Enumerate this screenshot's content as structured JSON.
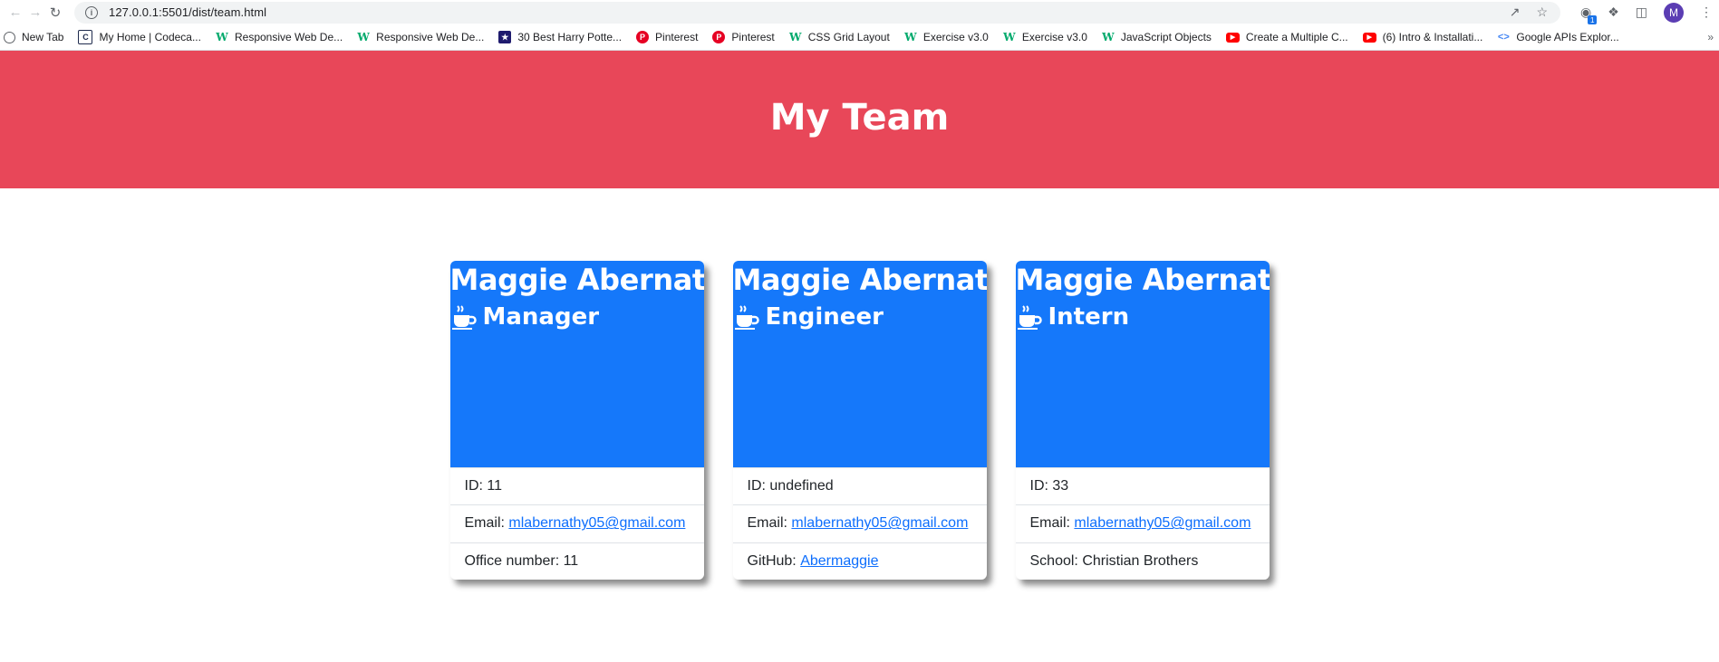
{
  "browser": {
    "url": "127.0.0.1:5501/dist/team.html",
    "avatar_letter": "M",
    "extension_badge": "1",
    "bookmarks": [
      {
        "label": "New Tab",
        "icon": "globe-icon"
      },
      {
        "label": "My Home | Codeca...",
        "icon": "codecademy-icon"
      },
      {
        "label": "Responsive Web De...",
        "icon": "w3schools-icon"
      },
      {
        "label": "Responsive Web De...",
        "icon": "w3schools-icon"
      },
      {
        "label": "30 Best Harry Potte...",
        "icon": "harry-potter-icon"
      },
      {
        "label": "Pinterest",
        "icon": "pinterest-icon"
      },
      {
        "label": "Pinterest",
        "icon": "pinterest-icon"
      },
      {
        "label": "CSS Grid Layout",
        "icon": "w3schools-icon"
      },
      {
        "label": "Exercise v3.0",
        "icon": "w3schools-icon"
      },
      {
        "label": "Exercise v3.0",
        "icon": "w3schools-icon"
      },
      {
        "label": "JavaScript Objects",
        "icon": "w3schools-icon"
      },
      {
        "label": "Create a Multiple C...",
        "icon": "youtube-icon"
      },
      {
        "label": "(6) Intro & Installati...",
        "icon": "youtube-icon"
      },
      {
        "label": "Google APIs Explor...",
        "icon": "google-apis-icon"
      }
    ]
  },
  "page": {
    "title": "My Team",
    "header_color": "#e84759",
    "card_color": "#1578fa"
  },
  "cards": [
    {
      "name": "Maggie Abernathy",
      "role": "Manager",
      "id_label": "ID: 11",
      "email_prefix": "Email: ",
      "email": "mlabernathy05@gmail.com",
      "extra_prefix": "Office number: 11",
      "extra_link": ""
    },
    {
      "name": "Maggie Abernathy",
      "role": "Engineer",
      "id_label": "ID: undefined",
      "email_prefix": "Email: ",
      "email": "mlabernathy05@gmail.com",
      "extra_prefix": "GitHub: ",
      "extra_link": "Abermaggie"
    },
    {
      "name": "Maggie Abernathy",
      "role": "Intern",
      "id_label": "ID: 33",
      "email_prefix": "Email: ",
      "email": "mlabernathy05@gmail.com",
      "extra_prefix": "School: Christian Brothers",
      "extra_link": ""
    }
  ]
}
